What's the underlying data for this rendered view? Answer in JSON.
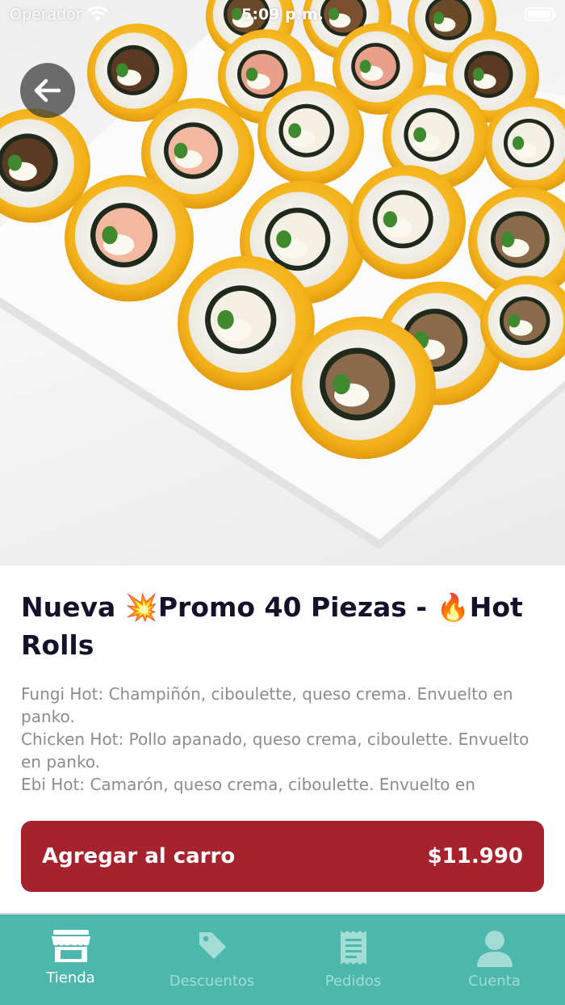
{
  "status_bar": {
    "carrier": "Operador",
    "time": "5:09 p.m."
  },
  "product": {
    "title": "Nueva 💥Promo 40 Piezas - 🔥Hot Rolls",
    "description": "Fungi Hot: Champiñón, ciboulette, queso crema. Envuelto en panko.\nChicken Hot: Pollo apanado, queso crema, ciboulette. Envuelto en panko.\nEbi Hot: Camarón, queso crema, ciboulette. Envuelto en"
  },
  "cart_button": {
    "label": "Agregar al carro",
    "price": "$11.990"
  },
  "tab_bar": {
    "tabs": [
      {
        "label": "Tienda",
        "icon": "store-icon",
        "active": true
      },
      {
        "label": "Descuentos",
        "icon": "tag-icon",
        "active": false
      },
      {
        "label": "Pedidos",
        "icon": "receipt-icon",
        "active": false
      },
      {
        "label": "Cuenta",
        "icon": "user-icon",
        "active": false
      }
    ]
  },
  "colors": {
    "accent": "#a6222c",
    "tab_bar": "#4cb8ad",
    "title": "#12122a",
    "description": "#8c8c8c"
  }
}
